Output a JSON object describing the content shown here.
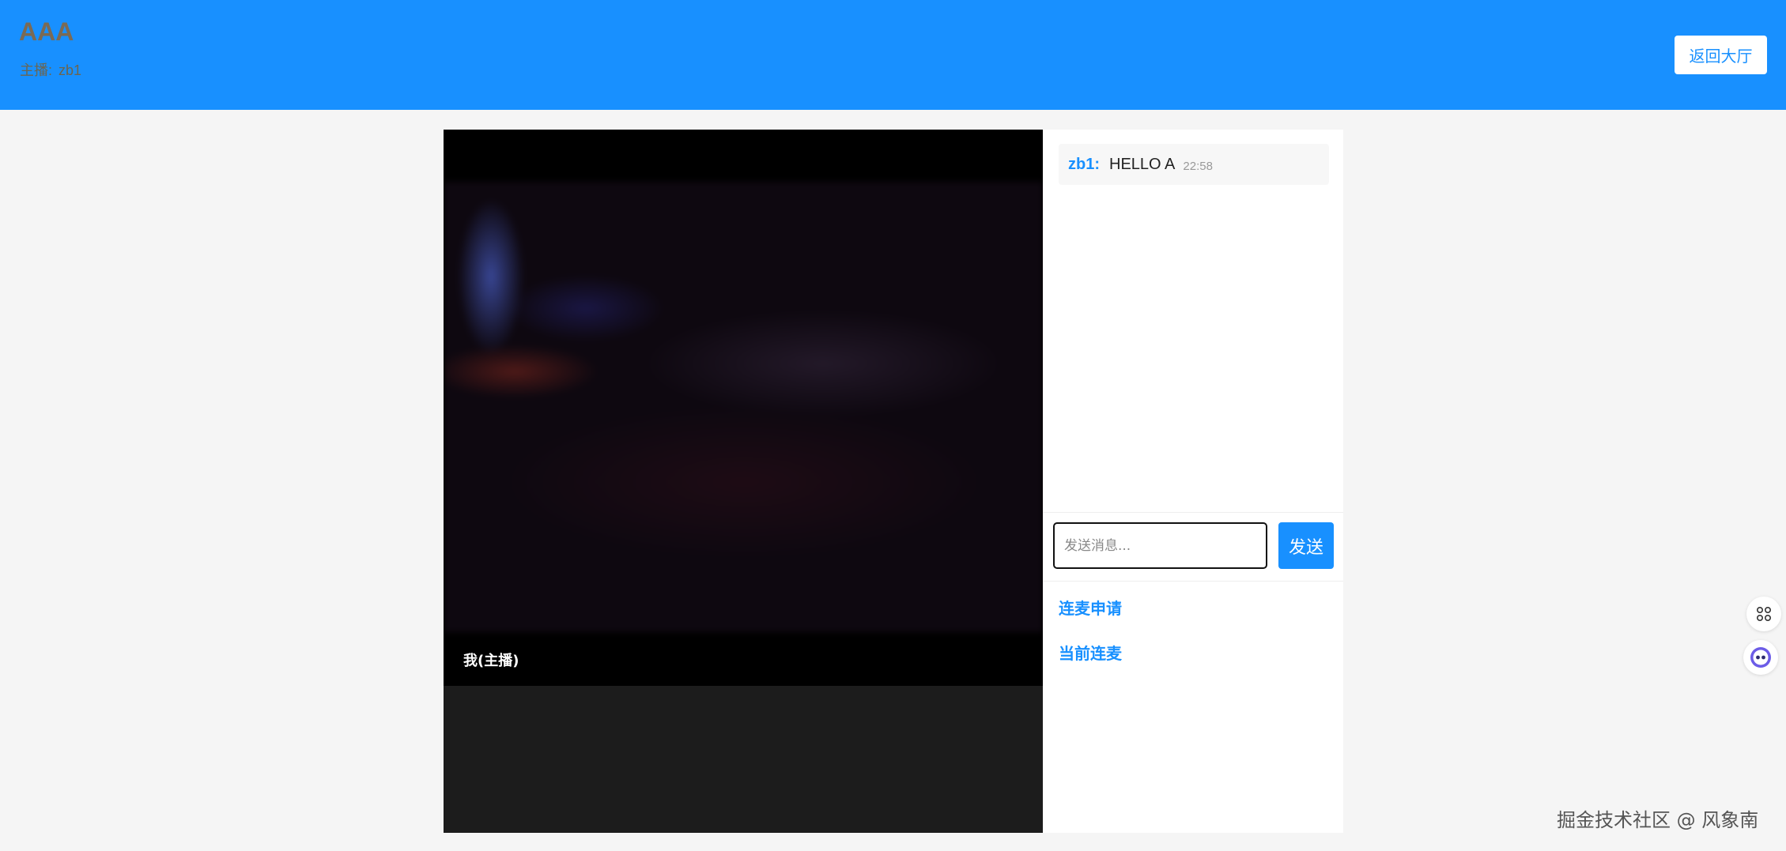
{
  "header": {
    "room_title": "AAA",
    "host_label": "主播:",
    "host_name": "zb1",
    "back_label": "返回大厅"
  },
  "video": {
    "label": "我(主播)"
  },
  "chat": {
    "messages": [
      {
        "user": "zb1:",
        "text": "HELLO A",
        "time": "22:58"
      }
    ],
    "input": {
      "placeholder": "发送消息...",
      "value": ""
    },
    "send_label": "发送"
  },
  "sections": {
    "apply_label": "连麦申请",
    "current_label": "当前连麦"
  },
  "floating": {
    "grid_icon": "grid-icon",
    "assistant_icon": "assistant-bot-icon"
  },
  "watermark": "掘金技术社区 @ 风象南",
  "colors": {
    "primary": "#1890ff",
    "page_background": "#f5f5f5",
    "video_background": "#000000"
  }
}
